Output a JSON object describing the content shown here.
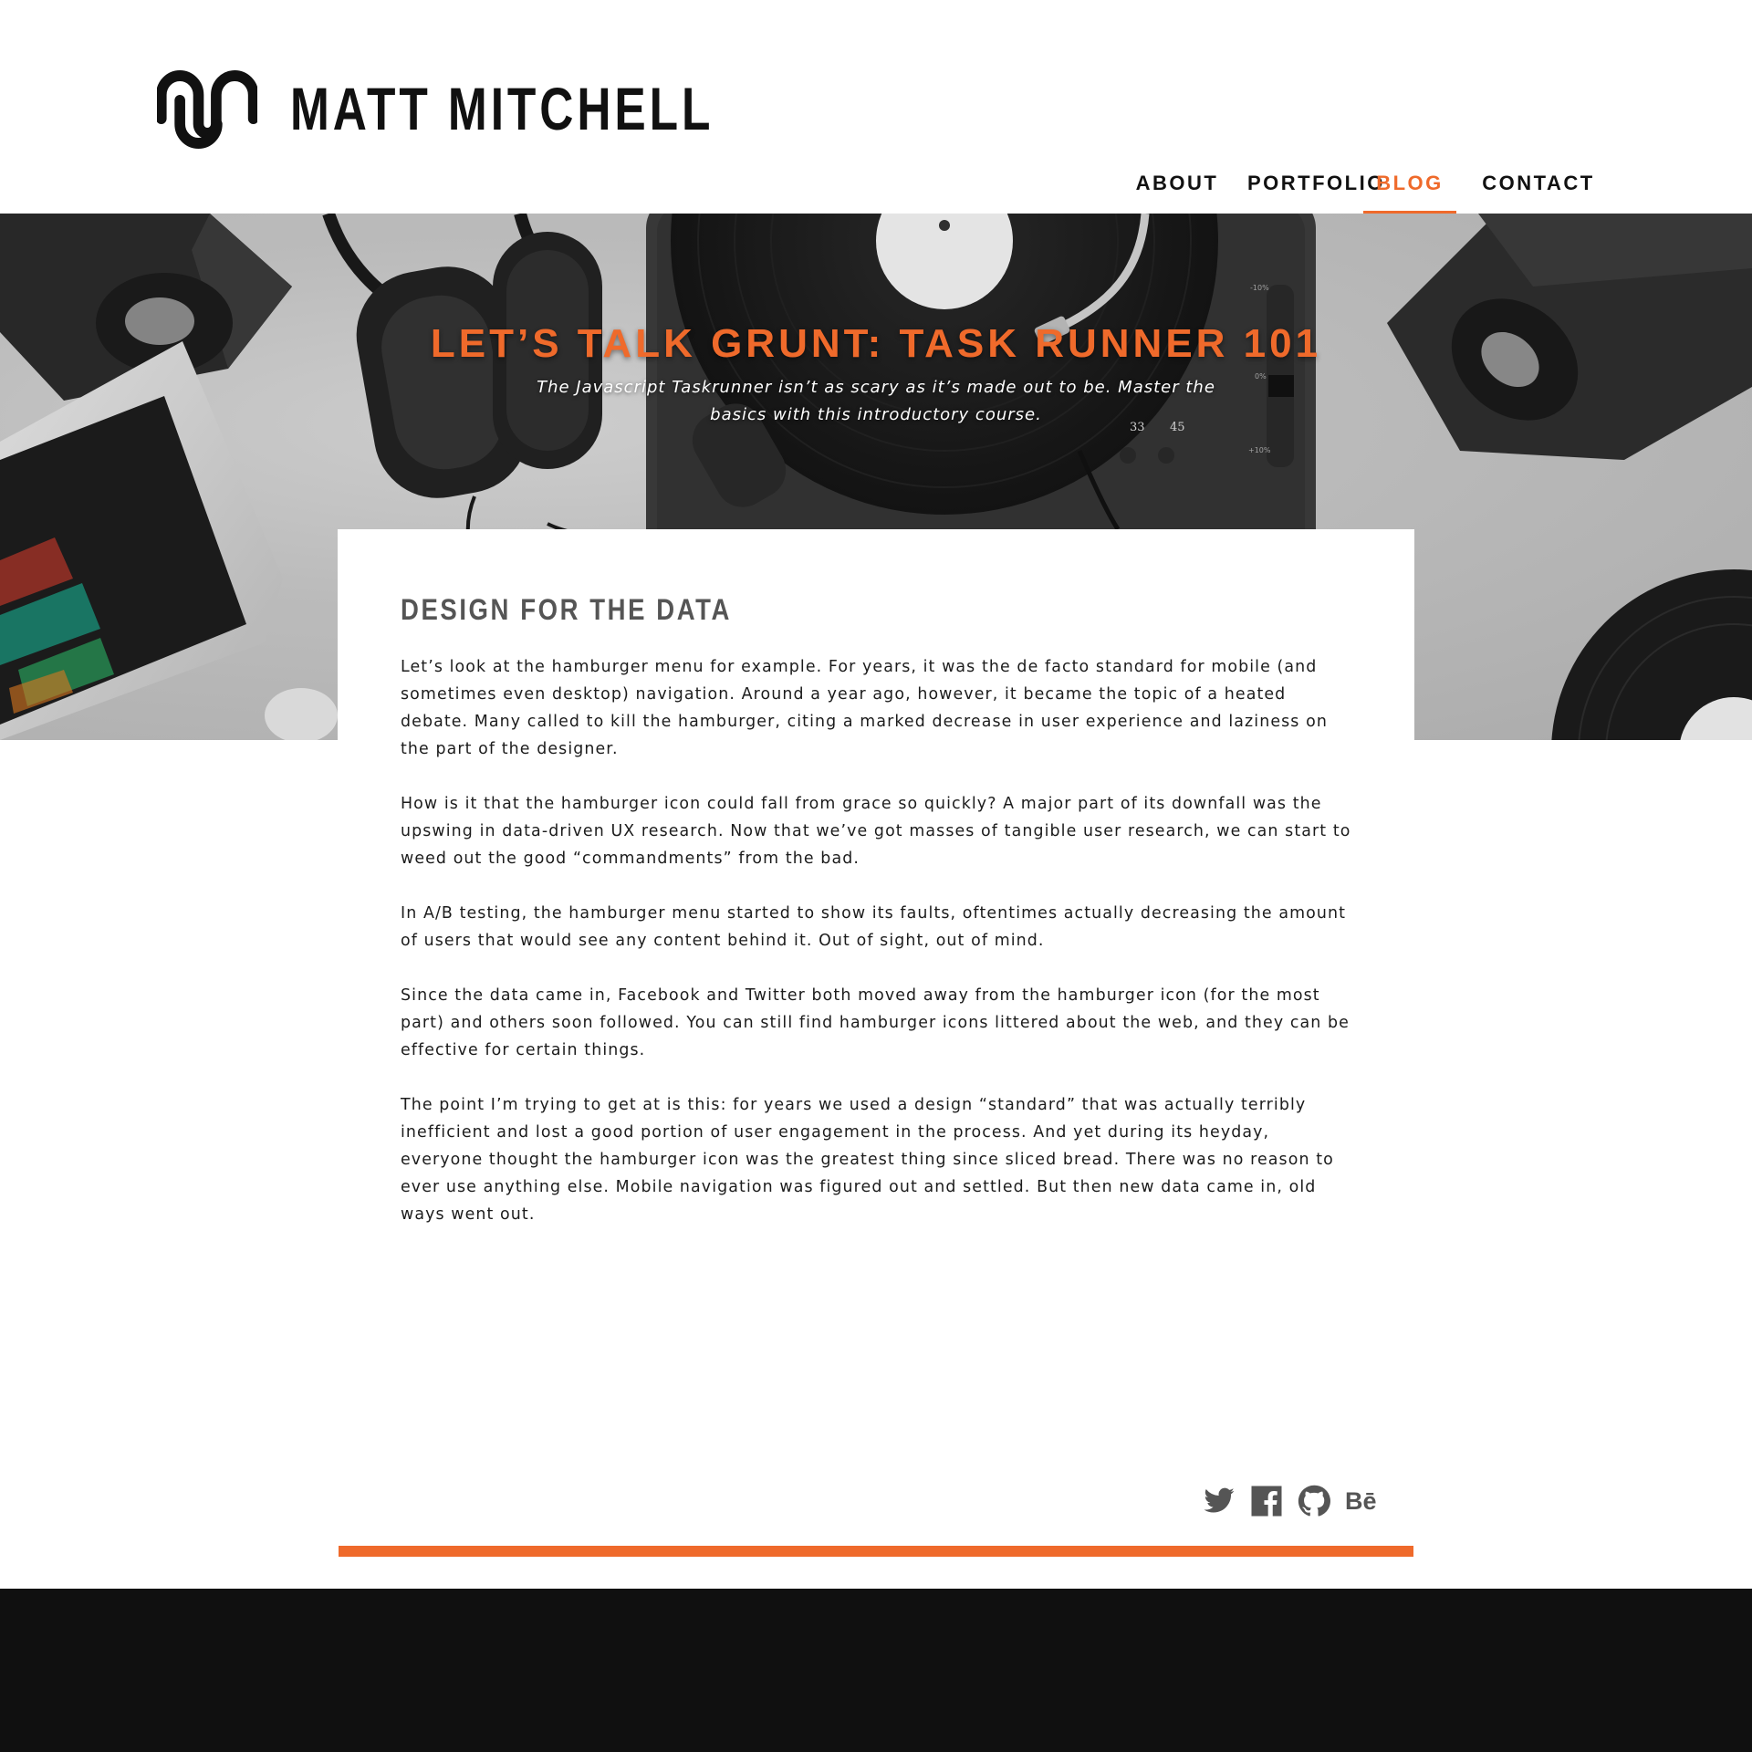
{
  "site": {
    "name": "MATT MITCHELL",
    "logo_icon": "mm-monogram-icon"
  },
  "nav": {
    "items": [
      {
        "label": "ABOUT",
        "active": false
      },
      {
        "label": "PORTFOLIO",
        "active": false
      },
      {
        "label": "BLOG",
        "active": true
      },
      {
        "label": "CONTACT",
        "active": false
      }
    ]
  },
  "hero": {
    "title": "LET’S TALK GRUNT: TASK RUNNER 101",
    "subtitle": "The Javascript Taskrunner isn’t as scary as it’s made out to be. Master the basics with this introductory course.",
    "turntable": {
      "speed_a": "33",
      "speed_b": "45",
      "pitch_top": "-10%",
      "pitch_mid": "0%",
      "pitch_bottom": "+10%"
    }
  },
  "article": {
    "heading": "DESIGN FOR THE DATA",
    "paragraphs": [
      "Let’s look at the hamburger menu for example. For years, it was the de facto standard for mobile (and sometimes even desktop) navigation. Around a year ago, however, it became the topic of a heated debate. Many called to kill the hamburger, citing a marked decrease in user experience and laziness on the part of the designer.",
      "How is it that the hamburger icon could fall from grace so quickly? A major part of its downfall was the upswing in data-driven UX research. Now that we’ve got masses of tangible user research, we can start to weed out the good “commandments” from the bad.",
      "In A/B testing, the hamburger menu started to show its faults, oftentimes actually decreasing the amount of users that would see any content behind it. Out of sight, out of mind.",
      "Since the data came in, Facebook and Twitter both moved away from the hamburger icon (for the most part) and others soon followed. You can still find hamburger icons littered about the web, and they can be effective for certain things.",
      "The point I’m trying to get at is this: for years we used a design “standard” that was actually terribly inefficient and lost a good portion of user engagement in the process. And yet during its heyday, everyone thought the hamburger icon was the greatest thing since sliced bread. There was no reason to ever use anything else. Mobile navigation was figured out and settled. But then new data came in, old ways went out."
    ]
  },
  "social": {
    "icons": [
      "twitter-icon",
      "facebook-icon",
      "github-icon",
      "behance-icon"
    ],
    "behance_label": "Bē"
  },
  "colors": {
    "accent": "#ef6a2b",
    "text": "#1c1c1c",
    "heading": "#555555",
    "footer": "#101010"
  }
}
